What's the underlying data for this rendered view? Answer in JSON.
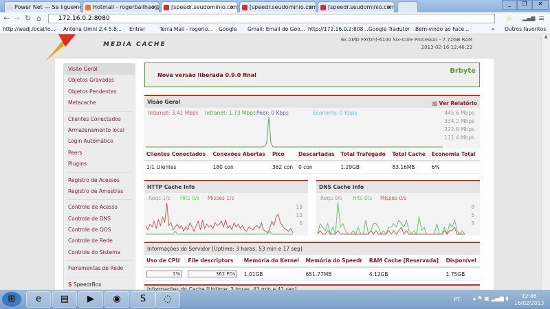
{
  "browser": {
    "tabs": [
      {
        "label": "Power Net --- Se ligue ne"
      },
      {
        "label": "Hotmail - rogerbailhao@"
      },
      {
        "label": "[speedr.seudominio.com."
      },
      {
        "label": "[speedr.seudominio.com."
      },
      {
        "label": "[speedr.seudominio.com."
      }
    ],
    "url": "172.16.0.2:8080",
    "bookmarks": [
      "http://wadj.local/lo...",
      "Antena Omni 2.4 5.8...",
      "Entrar",
      "Terra Mail - rogerio...",
      "Google",
      "Gmail: Email do Goo...",
      "http://172.16.0.2:808...",
      "Google Tradutor",
      "Bem-vindo ao Face..."
    ],
    "other_bookmarks": "Outros favoritos"
  },
  "header": {
    "logo_sub": "MEDIA CACHE",
    "cpu": "6x AMD FX(tm)-6100 Six-Core Processor - 7.72GB RAM",
    "datetime": "2013-02-16 12:46:23"
  },
  "sidebar": {
    "groups": [
      [
        "Visão Geral",
        "Objetos Gravados",
        "Objetos Pendentes",
        "Metacache"
      ],
      [
        "Clientes Conectados",
        "Armazenamento local",
        "Login Automático",
        "Peers",
        "Plugins"
      ],
      [
        "Registro de Acessos",
        "Registro de Amostras"
      ],
      [
        "Controle de Acesso",
        "Controle de DNS",
        "Controle de QOS",
        "Controle de Rede",
        "Controle do Sistema"
      ],
      [
        "Ferramentas de Rede"
      ],
      [
        "SpeedrBox"
      ]
    ]
  },
  "notice": {
    "text": "Nova versão liberada 0.9.0 final",
    "logo": "Brbyte"
  },
  "overview": {
    "title": "Visão Geral",
    "report_link": "Ver Relatório",
    "legend": [
      "Internet: 3.41 Mbps",
      "Intranet: 1.73 Mbps",
      "Peer: 0 Kbps",
      "Economy: 0 Kbps"
    ],
    "yticks": [
      "445.6 Mbps",
      "334.2 Mbps",
      "222.8 Mbps",
      "111.4 Mbps"
    ],
    "columns": [
      "Clientes Conectados",
      "Conexões Abertas",
      "Pico",
      "Descartadas",
      "Total Trafegado",
      "Total Cache",
      "Economia Total"
    ],
    "row": [
      "1/1 clientes",
      "180 con",
      "362 con",
      "0 con",
      "1.29GB",
      "83.16MB",
      "6%"
    ]
  },
  "http_cache": {
    "title": "HTTP Cache Info",
    "legend": [
      "Reqs 1/s",
      "Hits 0/s",
      "Misses 1/s"
    ],
    "yticks": [
      "19",
      "13",
      "6"
    ]
  },
  "dns_cache": {
    "title": "DNS Cache Info",
    "legend": [
      "Reqs 0/s",
      "Hits 0/s",
      "Misses 0/s"
    ],
    "yticks": [
      "8",
      "5",
      "3"
    ]
  },
  "server": {
    "title": "Informações do Servidor [Uptime: 3 horas, 53 min e 17 seg]",
    "columns": [
      "Uso de CPU",
      "File descriptors",
      "Memória do Kernel",
      "Memória do Speedr",
      "RAM Cache [Reservada]",
      "Disponível"
    ],
    "cpu": "1%",
    "cpu_fraction": 0.01,
    "fds": "362 FDs",
    "row": [
      "1.01GB",
      "651.77MB",
      "4.12GB",
      "1.75GB"
    ]
  },
  "cache_info": {
    "title": "Informações do Cache [Uptime: 3 horas, 43 min e 41 seg]"
  },
  "taskbar": {
    "lang": "PT",
    "time": "12:46",
    "date": "16/02/2013"
  },
  "chart_data": [
    {
      "type": "line",
      "title": "Visão Geral",
      "series": [
        {
          "name": "Intranet",
          "color": "#5aa55a",
          "values": [
            0,
            0,
            0,
            0,
            0,
            0,
            0,
            0,
            0,
            0,
            0,
            0,
            0,
            0,
            0,
            0,
            0,
            0,
            0,
            0,
            0,
            0,
            0,
            0,
            0,
            0,
            0,
            0,
            0,
            0,
            0,
            0,
            0,
            0,
            0,
            0,
            0,
            0,
            0,
            0,
            0,
            0,
            0,
            0,
            0,
            0,
            0,
            0,
            0,
            0,
            0,
            0,
            0,
            0,
            0,
            0,
            10,
            60,
            445,
            60,
            0,
            0,
            0,
            0,
            0,
            0,
            0,
            0,
            0,
            0,
            0,
            0,
            0,
            0,
            0,
            0,
            0,
            0,
            0,
            0,
            0,
            0,
            0,
            0,
            0,
            0,
            0,
            0,
            0,
            0,
            0,
            0,
            0,
            0,
            0,
            0,
            0,
            0,
            0,
            0,
            0,
            0,
            0,
            0,
            0,
            0,
            0,
            0,
            0,
            0,
            0,
            0,
            0,
            0,
            0,
            0,
            0,
            0,
            0,
            0,
            0,
            0,
            0,
            0,
            0,
            0,
            0,
            0,
            0,
            0,
            0,
            0,
            0,
            0,
            0,
            0,
            0,
            0,
            0,
            0,
            0
          ]
        }
      ],
      "ylim": [
        0,
        460
      ]
    },
    {
      "type": "line",
      "title": "HTTP Cache Info",
      "series": [
        {
          "name": "Misses",
          "color": "#c0605a",
          "values": [
            6,
            3,
            7,
            5,
            9,
            4,
            10,
            6,
            12,
            8,
            22,
            6,
            8,
            3,
            5,
            7,
            4,
            6,
            2,
            5,
            3,
            8,
            5,
            2,
            6,
            9,
            3,
            10,
            4,
            7,
            5,
            6,
            4,
            8,
            6,
            7,
            9,
            5,
            10,
            4,
            6,
            3,
            8,
            5,
            7,
            4,
            6,
            3,
            2,
            5,
            4,
            3,
            5,
            6,
            4,
            8,
            3,
            2,
            1,
            4,
            9,
            6,
            12,
            14,
            8,
            6,
            4,
            3,
            2,
            4,
            1
          ]
        },
        {
          "name": "Hits",
          "color": "#6bc46b",
          "values": [
            0,
            0,
            0,
            0,
            0,
            0,
            0,
            0,
            0,
            0,
            0,
            0,
            0,
            0,
            2,
            0,
            0,
            0,
            0,
            0,
            0,
            0,
            0,
            0,
            0,
            0,
            0,
            0,
            0,
            0,
            0,
            0,
            0,
            0,
            0,
            0,
            0,
            0,
            0,
            0,
            0,
            0,
            0,
            0,
            0,
            0,
            0,
            0,
            0,
            0,
            0,
            0,
            0,
            0,
            0,
            0,
            0,
            0,
            0,
            2,
            0,
            0,
            0,
            0,
            0,
            0,
            0,
            0,
            0,
            0,
            0
          ]
        }
      ],
      "ylim": [
        0,
        22
      ]
    },
    {
      "type": "line",
      "title": "DNS Cache Info",
      "series": [
        {
          "name": "Hits",
          "color": "#6bc46b",
          "values": [
            0,
            3,
            2,
            1,
            3,
            0,
            2,
            0,
            9,
            2,
            3,
            1,
            0,
            0,
            1,
            0,
            2,
            0,
            0,
            4,
            0,
            1,
            3,
            3,
            2,
            0,
            1,
            0,
            2,
            2,
            3,
            2,
            4,
            3,
            2,
            4,
            1,
            0,
            1,
            0,
            5,
            1,
            2,
            0,
            0,
            0,
            0,
            3,
            0,
            0,
            2,
            0,
            3,
            2,
            4,
            1,
            0,
            1,
            0
          ]
        },
        {
          "name": "Misses",
          "color": "#c0605a",
          "values": [
            0,
            1,
            0,
            0,
            1,
            0,
            0,
            0,
            1,
            0,
            0,
            0,
            0,
            0,
            0,
            0,
            0,
            0,
            0,
            0,
            0,
            1,
            0,
            1,
            0,
            0,
            0,
            0,
            1,
            0,
            1,
            0,
            1,
            2,
            0,
            1,
            0,
            0,
            0,
            0,
            0,
            0,
            0,
            0,
            0,
            0,
            0,
            0,
            0,
            0,
            1,
            0,
            1,
            1,
            2,
            0,
            0,
            0,
            0
          ]
        }
      ],
      "ylim": [
        0,
        9
      ]
    }
  ]
}
